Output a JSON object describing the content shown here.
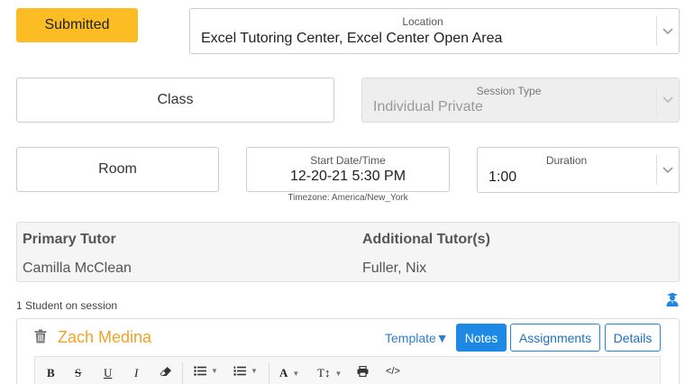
{
  "status": {
    "label": "Submitted",
    "color": "#fbbd23"
  },
  "location": {
    "label": "Location",
    "value": "Excel Tutoring Center, Excel Center Open Area"
  },
  "class_button": {
    "label": "Class"
  },
  "session_type": {
    "label": "Session Type",
    "value": "Individual Private",
    "disabled": true
  },
  "room_button": {
    "label": "Room"
  },
  "start": {
    "label": "Start Date/Time",
    "value": "12-20-21 5:30 PM",
    "timezone": "Timezone: America/New_York"
  },
  "duration": {
    "label": "Duration",
    "value": "1:00"
  },
  "tutors": {
    "primary_header": "Primary Tutor",
    "additional_header": "Additional Tutor(s)",
    "primary": "Camilla McClean",
    "additional": "Fuller, Nix"
  },
  "students": {
    "count_label": "1 Student on session"
  },
  "student": {
    "name": "Zach Medina",
    "template_label": "Template▼",
    "tabs": [
      {
        "label": "Notes",
        "active": true
      },
      {
        "label": "Assignments",
        "active": false
      },
      {
        "label": "Details",
        "active": false
      }
    ]
  },
  "editor_toolbar": {
    "bold": "B",
    "strike": "S",
    "underline": "U",
    "italic": "I",
    "font": "A",
    "font_size": "T↕",
    "code": "</>"
  },
  "colors": {
    "accent": "#1e88e5",
    "name_orange": "#f0a326"
  }
}
